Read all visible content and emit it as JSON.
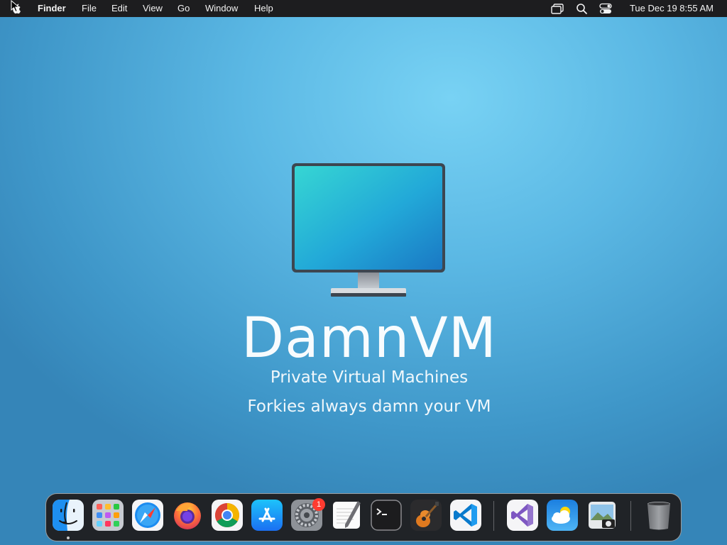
{
  "menubar": {
    "app_name": "Finder",
    "items": [
      "File",
      "Edit",
      "View",
      "Go",
      "Window",
      "Help"
    ],
    "status_icons": [
      "screen-mirroring-icon",
      "search-icon",
      "control-center-icon"
    ],
    "clock": "Tue Dec 19  8:55 AM"
  },
  "wallpaper": {
    "title": "DamnVM",
    "subtitle": "Private Virtual Machines",
    "tagline": "Forkies always damn your VM"
  },
  "dock": {
    "apps": [
      {
        "name": "finder-icon",
        "running": true
      },
      {
        "name": "launchpad-icon"
      },
      {
        "name": "safari-icon"
      },
      {
        "name": "firefox-icon"
      },
      {
        "name": "chrome-icon"
      },
      {
        "name": "app-store-icon"
      },
      {
        "name": "system-settings-icon",
        "badge": "1"
      },
      {
        "name": "textedit-icon"
      },
      {
        "name": "terminal-icon"
      },
      {
        "name": "garageband-icon"
      },
      {
        "name": "vscode-icon"
      },
      {
        "name": "visual-studio-icon"
      },
      {
        "name": "weather-icon"
      },
      {
        "name": "preview-icon"
      },
      {
        "name": "trash-icon"
      }
    ],
    "badge_color": "#ff3b30"
  },
  "colors": {
    "menubar": "#1d1d1f",
    "wallpaper_center": "#78d2f4",
    "wallpaper_edge": "#3585b8"
  }
}
